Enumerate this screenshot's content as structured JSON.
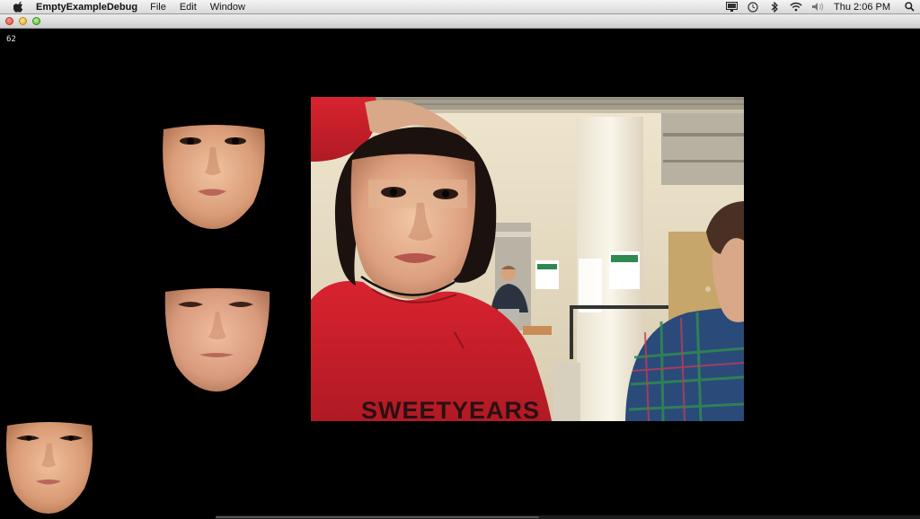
{
  "menubar": {
    "app_name": "EmptyExampleDebug",
    "menus": [
      "File",
      "Edit",
      "Window"
    ],
    "clock": "Thu 2:06 PM",
    "status_icons": [
      "display-icon",
      "time-machine-icon",
      "bluetooth-icon",
      "wifi-icon",
      "volume-icon"
    ]
  },
  "app": {
    "fps": "62"
  },
  "camera": {
    "hoodie_text": "SWEETYEARS"
  },
  "colors": {
    "background": "#000000",
    "hoodie": "#c8202a",
    "skin": "#e3ad8a"
  }
}
